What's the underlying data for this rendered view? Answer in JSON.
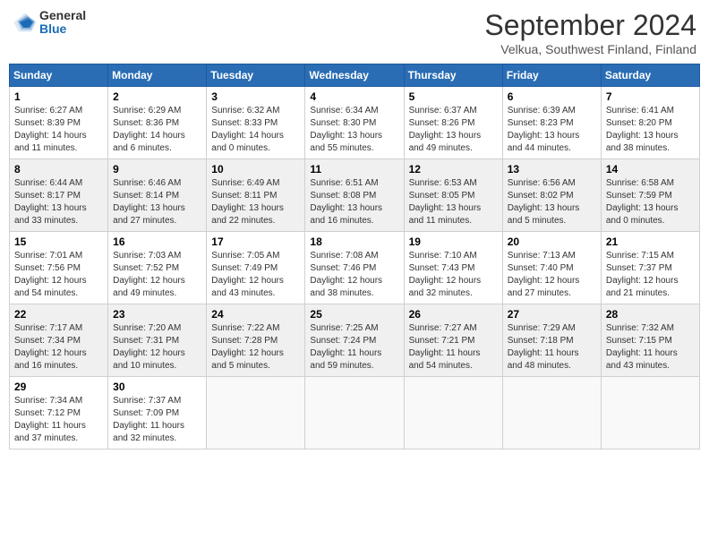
{
  "header": {
    "logo": {
      "line1": "General",
      "line2": "Blue"
    },
    "title": "September 2024",
    "subtitle": "Velkua, Southwest Finland, Finland"
  },
  "days_of_week": [
    "Sunday",
    "Monday",
    "Tuesday",
    "Wednesday",
    "Thursday",
    "Friday",
    "Saturday"
  ],
  "weeks": [
    [
      {
        "day": "1",
        "sunrise": "6:27 AM",
        "sunset": "8:39 PM",
        "daylight": "14 hours and 11 minutes."
      },
      {
        "day": "2",
        "sunrise": "6:29 AM",
        "sunset": "8:36 PM",
        "daylight": "14 hours and 6 minutes."
      },
      {
        "day": "3",
        "sunrise": "6:32 AM",
        "sunset": "8:33 PM",
        "daylight": "14 hours and 0 minutes."
      },
      {
        "day": "4",
        "sunrise": "6:34 AM",
        "sunset": "8:30 PM",
        "daylight": "13 hours and 55 minutes."
      },
      {
        "day": "5",
        "sunrise": "6:37 AM",
        "sunset": "8:26 PM",
        "daylight": "13 hours and 49 minutes."
      },
      {
        "day": "6",
        "sunrise": "6:39 AM",
        "sunset": "8:23 PM",
        "daylight": "13 hours and 44 minutes."
      },
      {
        "day": "7",
        "sunrise": "6:41 AM",
        "sunset": "8:20 PM",
        "daylight": "13 hours and 38 minutes."
      }
    ],
    [
      {
        "day": "8",
        "sunrise": "6:44 AM",
        "sunset": "8:17 PM",
        "daylight": "13 hours and 33 minutes."
      },
      {
        "day": "9",
        "sunrise": "6:46 AM",
        "sunset": "8:14 PM",
        "daylight": "13 hours and 27 minutes."
      },
      {
        "day": "10",
        "sunrise": "6:49 AM",
        "sunset": "8:11 PM",
        "daylight": "13 hours and 22 minutes."
      },
      {
        "day": "11",
        "sunrise": "6:51 AM",
        "sunset": "8:08 PM",
        "daylight": "13 hours and 16 minutes."
      },
      {
        "day": "12",
        "sunrise": "6:53 AM",
        "sunset": "8:05 PM",
        "daylight": "13 hours and 11 minutes."
      },
      {
        "day": "13",
        "sunrise": "6:56 AM",
        "sunset": "8:02 PM",
        "daylight": "13 hours and 5 minutes."
      },
      {
        "day": "14",
        "sunrise": "6:58 AM",
        "sunset": "7:59 PM",
        "daylight": "13 hours and 0 minutes."
      }
    ],
    [
      {
        "day": "15",
        "sunrise": "7:01 AM",
        "sunset": "7:56 PM",
        "daylight": "12 hours and 54 minutes."
      },
      {
        "day": "16",
        "sunrise": "7:03 AM",
        "sunset": "7:52 PM",
        "daylight": "12 hours and 49 minutes."
      },
      {
        "day": "17",
        "sunrise": "7:05 AM",
        "sunset": "7:49 PM",
        "daylight": "12 hours and 43 minutes."
      },
      {
        "day": "18",
        "sunrise": "7:08 AM",
        "sunset": "7:46 PM",
        "daylight": "12 hours and 38 minutes."
      },
      {
        "day": "19",
        "sunrise": "7:10 AM",
        "sunset": "7:43 PM",
        "daylight": "12 hours and 32 minutes."
      },
      {
        "day": "20",
        "sunrise": "7:13 AM",
        "sunset": "7:40 PM",
        "daylight": "12 hours and 27 minutes."
      },
      {
        "day": "21",
        "sunrise": "7:15 AM",
        "sunset": "7:37 PM",
        "daylight": "12 hours and 21 minutes."
      }
    ],
    [
      {
        "day": "22",
        "sunrise": "7:17 AM",
        "sunset": "7:34 PM",
        "daylight": "12 hours and 16 minutes."
      },
      {
        "day": "23",
        "sunrise": "7:20 AM",
        "sunset": "7:31 PM",
        "daylight": "12 hours and 10 minutes."
      },
      {
        "day": "24",
        "sunrise": "7:22 AM",
        "sunset": "7:28 PM",
        "daylight": "12 hours and 5 minutes."
      },
      {
        "day": "25",
        "sunrise": "7:25 AM",
        "sunset": "7:24 PM",
        "daylight": "11 hours and 59 minutes."
      },
      {
        "day": "26",
        "sunrise": "7:27 AM",
        "sunset": "7:21 PM",
        "daylight": "11 hours and 54 minutes."
      },
      {
        "day": "27",
        "sunrise": "7:29 AM",
        "sunset": "7:18 PM",
        "daylight": "11 hours and 48 minutes."
      },
      {
        "day": "28",
        "sunrise": "7:32 AM",
        "sunset": "7:15 PM",
        "daylight": "11 hours and 43 minutes."
      }
    ],
    [
      {
        "day": "29",
        "sunrise": "7:34 AM",
        "sunset": "7:12 PM",
        "daylight": "11 hours and 37 minutes."
      },
      {
        "day": "30",
        "sunrise": "7:37 AM",
        "sunset": "7:09 PM",
        "daylight": "11 hours and 32 minutes."
      },
      null,
      null,
      null,
      null,
      null
    ]
  ]
}
